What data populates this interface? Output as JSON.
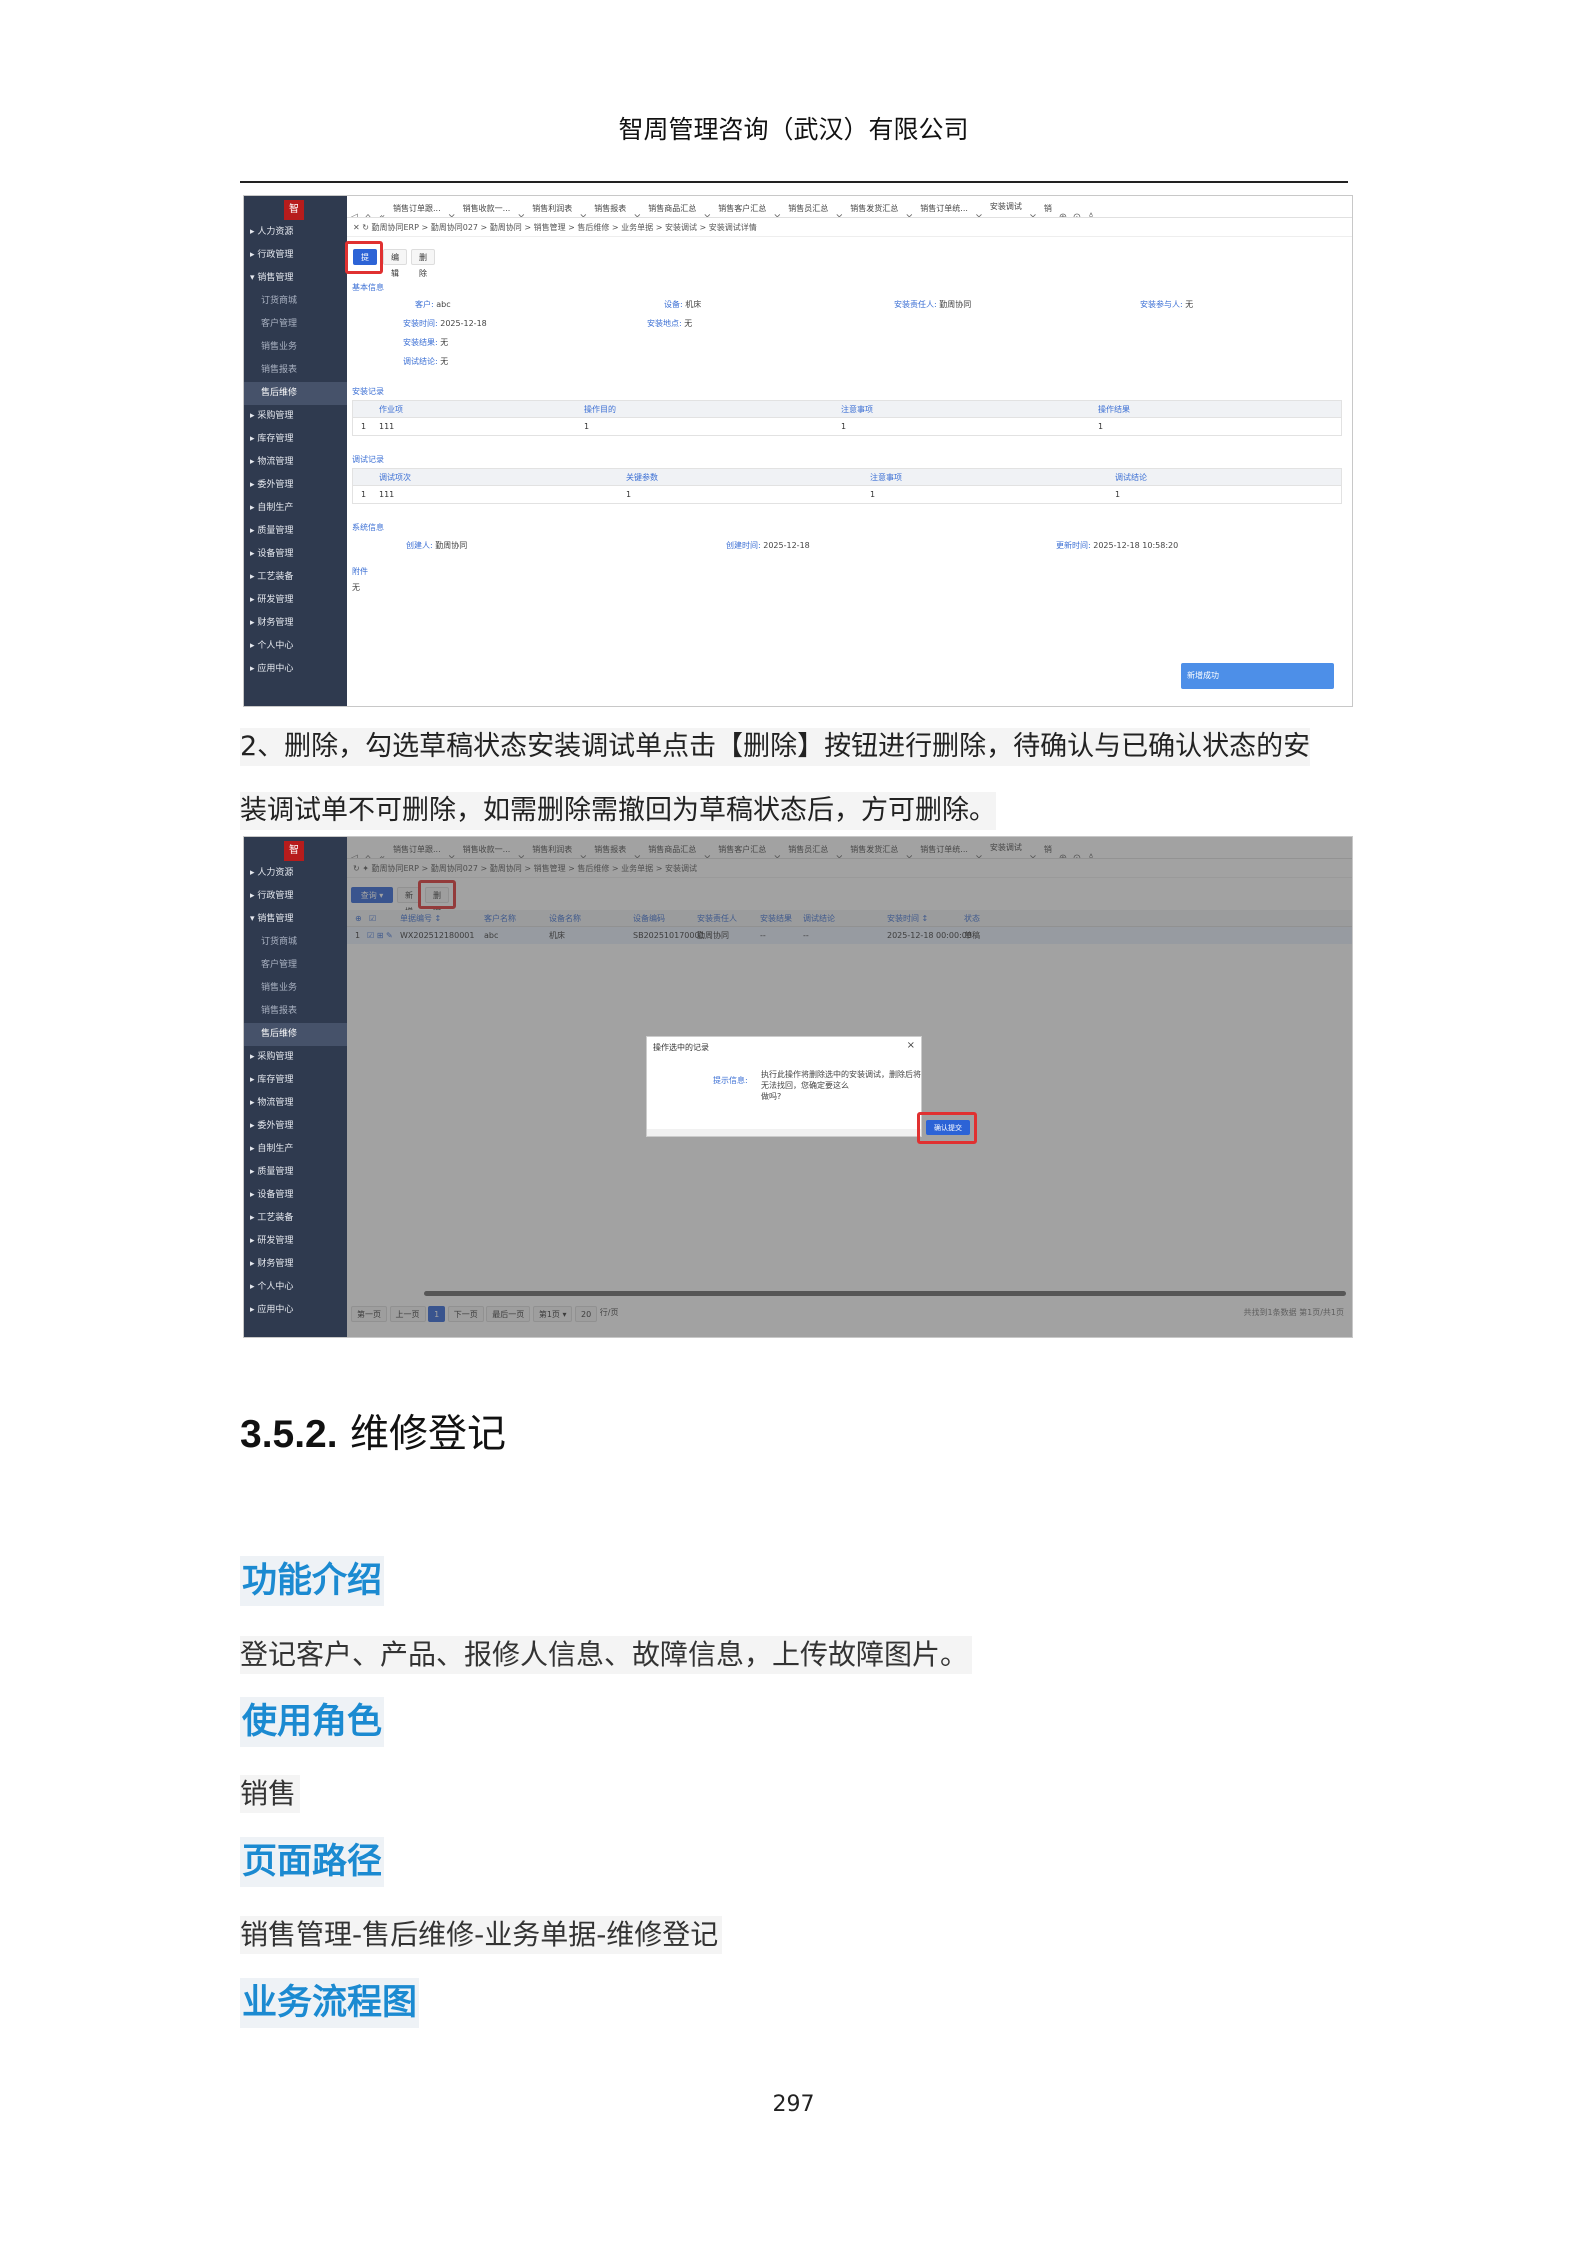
{
  "page_header": "智周管理咨询（武汉）有限公司",
  "shot1": {
    "sidebar": [
      "人力资源",
      "行政管理",
      "销售管理",
      "订货商城",
      "客户管理",
      "销售业务",
      "销售报表",
      "售后维修",
      "采购管理",
      "库存管理",
      "物流管理",
      "委外管理",
      "自制生产",
      "质量管理",
      "设备管理",
      "工艺装备",
      "研发管理",
      "财务管理",
      "个人中心",
      "应用中心"
    ],
    "tabs": [
      "销售订单跟...",
      "销售收款一...",
      "销售利润表",
      "销售报表",
      "销售商品汇总",
      "销售客户汇总",
      "销售员汇总",
      "销售发货汇总",
      "销售订单统...",
      "安装调试"
    ],
    "tab_right": "销",
    "breadcrumb": "勤周协同ERP > 勤周协同027 > 勤周协同 > 销售管理 > 售后维修 > 业务单据 > 安装调试 > 安装调试详情",
    "buttons": {
      "submit": "提交",
      "edit": "编辑",
      "delete": "删除"
    },
    "basic_title": "基本信息",
    "basic": [
      {
        "k": "客户:",
        "v": "abc"
      },
      {
        "k": "设备:",
        "v": "机床"
      },
      {
        "k": "安装责任人:",
        "v": "勤周协同"
      },
      {
        "k": "安装参与人:",
        "v": "无"
      },
      {
        "k": "安装时间:",
        "v": "2025-12-18"
      },
      {
        "k": "安装地点:",
        "v": "无"
      },
      {
        "k": "安装结果:",
        "v": "无"
      },
      {
        "k": "调试结论:",
        "v": "无"
      }
    ],
    "install_title": "安装记录",
    "install_headers": [
      "作业项",
      "操作目的",
      "注意事项",
      "操作结果"
    ],
    "install_row": [
      "1",
      "111",
      "1",
      "1",
      "1"
    ],
    "debug_title": "调试记录",
    "debug_headers": [
      "调试项次",
      "关键参数",
      "注意事项",
      "调试结论"
    ],
    "debug_row": [
      "1",
      "111",
      "1",
      "1",
      "1"
    ],
    "sys_title": "系统信息",
    "sys": [
      {
        "k": "创建人:",
        "v": "勤周协同"
      },
      {
        "k": "创建时间:",
        "v": "2025-12-18"
      },
      {
        "k": "更新时间:",
        "v": "2025-12-18 10:58:20"
      }
    ],
    "attach_title": "附件",
    "attach_value": "无",
    "toast": "新增成功"
  },
  "para1_line1": "2、删除，勾选草稿状态安装调试单点击【删除】按钮进行删除，待确认与已确认状态的安",
  "para1_line2": "装调试单不可删除，如需删除需撤回为草稿状态后，方可删除。",
  "shot2": {
    "breadcrumb": "勤周协同ERP > 勤周协同027 > 勤周协同 > 销售管理 > 售后维修 > 业务单据 > 安装调试",
    "buttons": {
      "query": "查询",
      "add": "新增",
      "delete": "删除"
    },
    "headers": [
      "单据编号 ↕",
      "客户名称",
      "设备名称",
      "设备编码",
      "安装责任人",
      "安装结果",
      "调试结论",
      "安装时间 ↕",
      "状态"
    ],
    "row": [
      "WX202512180001",
      "abc",
      "机床",
      "SB202510170001",
      "勤周协同",
      "--",
      "--",
      "2025-12-18 00:00:00",
      "草稿"
    ],
    "row_index": "1",
    "dialog": {
      "title": "操作选中的记录",
      "label": "提示信息:",
      "message_l1": "执行此操作将删除选中的安装调试，删除后将无法找回，您确定要这么",
      "message_l2": "做吗?",
      "confirm": "确认提交"
    },
    "pager": {
      "first": "第一页",
      "prev": "上一页",
      "page": "1",
      "next": "下一页",
      "last": "最后一页",
      "jump": "第1页",
      "size": "20",
      "unit": "行/页",
      "summary": "共找到1条数据 第1页/共1页"
    }
  },
  "section_number": "3.5.2.",
  "section_title": "维修登记",
  "h_func": "功能介绍",
  "func_text": "登记客户、产品、报修人信息、故障信息，上传故障图片。",
  "h_role": "使用角色",
  "role_text": "销售",
  "h_path": "页面路径",
  "path_text": "销售管理-售后维修-业务单据-维修登记",
  "h_flow": "业务流程图",
  "page_number": "297"
}
